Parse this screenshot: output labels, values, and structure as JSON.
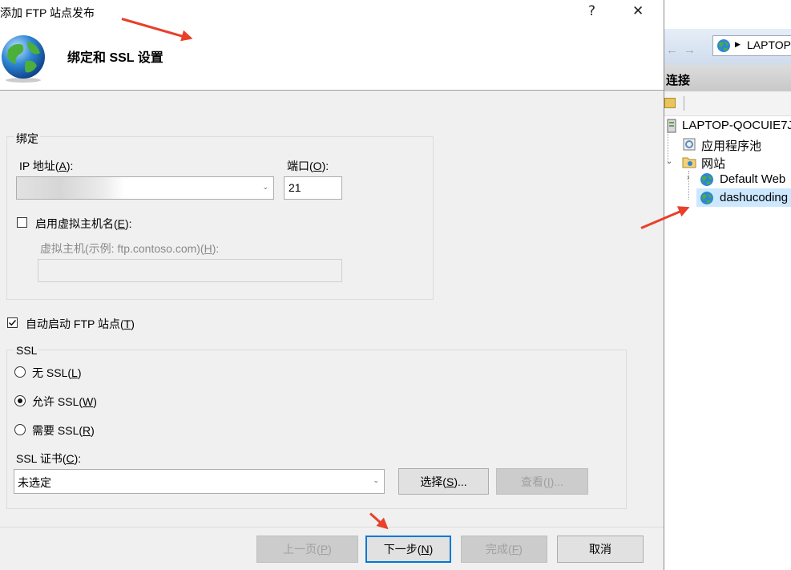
{
  "dialog": {
    "title": "添加 FTP 站点发布",
    "help_glyph": "?",
    "close_glyph": "✕",
    "header_title": "绑定和 SSL 设置"
  },
  "binding": {
    "group_label": "绑定",
    "ip_label": "IP 地址(",
    "ip_key": "A",
    "ip_suffix": "):",
    "ip_value": "",
    "port_label": "端口(",
    "port_key": "O",
    "port_suffix": "):",
    "port_value": "21",
    "vhost_checkbox_label": "启用虚拟主机名(",
    "vhost_key": "E",
    "vhost_suffix": "):",
    "vhost_field_label": "虚拟主机(示例: ftp.contoso.com)(",
    "vhost_field_key": "H",
    "vhost_field_suffix": "):",
    "vhost_value": ""
  },
  "autostart": {
    "label": "自动启动 FTP 站点(",
    "key": "T",
    "suffix": ")",
    "checked": true
  },
  "ssl": {
    "group_label": "SSL",
    "options": [
      {
        "label": "无 SSL(",
        "key": "L",
        "suffix": ")",
        "selected": false
      },
      {
        "label": "允许 SSL(",
        "key": "W",
        "suffix": ")",
        "selected": true
      },
      {
        "label": "需要 SSL(",
        "key": "R",
        "suffix": ")",
        "selected": false
      }
    ],
    "cert_label": "SSL 证书(",
    "cert_key": "C",
    "cert_suffix": "):",
    "cert_value": "未选定",
    "select_btn": "选择(",
    "select_key": "S",
    "select_suffix": ")...",
    "view_btn": "查看(",
    "view_key": "I",
    "view_suffix": ")..."
  },
  "footer": {
    "prev": "上一页(",
    "prev_key": "P",
    "prev_suffix": ")",
    "next": "下一步(",
    "next_key": "N",
    "next_suffix": ")",
    "finish": "完成(",
    "finish_key": "F",
    "finish_suffix": ")",
    "cancel": "取消"
  },
  "iis": {
    "address": "LAPTOP",
    "connections_label": "连接",
    "tree": {
      "server": "LAPTOP-QOCUIE7J",
      "app_pools": "应用程序池",
      "sites": "网站",
      "site1": "Default Web",
      "site2": "dashucoding"
    }
  },
  "colors": {
    "accent": "#0078d7",
    "annotation_arrow": "#e8402a",
    "selection": "#cce8ff"
  }
}
